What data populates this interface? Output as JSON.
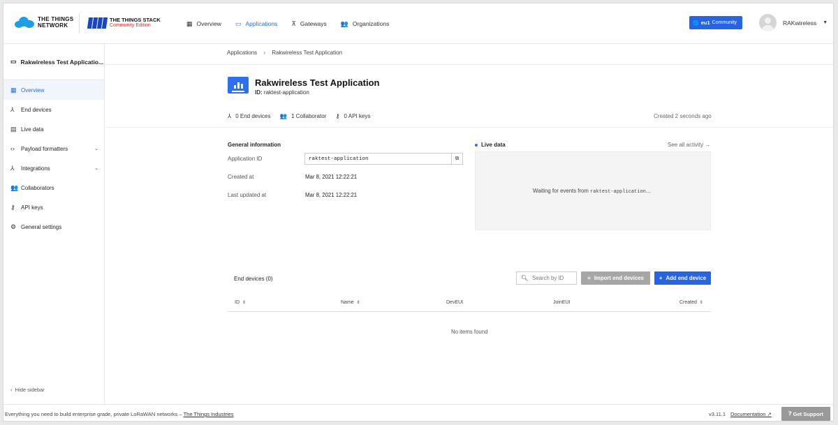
{
  "header": {
    "ttn_logo_line1": "THE THINGS",
    "ttn_logo_line2": "NETWORK",
    "tts_logo_line1": "THE THINGS STACK",
    "tts_logo_line2": "Community Edition",
    "nav": [
      {
        "label": "Overview",
        "icon": "dashboard-icon",
        "active": false
      },
      {
        "label": "Applications",
        "icon": "applications-icon",
        "active": true
      },
      {
        "label": "Gateways",
        "icon": "gateway-icon",
        "active": false
      },
      {
        "label": "Organizations",
        "icon": "organizations-icon",
        "active": false
      }
    ],
    "cluster": {
      "region": "eu1",
      "label": "Community"
    },
    "user": {
      "name": "RAKwireless"
    }
  },
  "sidebar": {
    "title": "Rakwireless Test Applicatio...",
    "items": [
      {
        "label": "Overview",
        "icon": "dashboard-icon",
        "active": true
      },
      {
        "label": "End devices",
        "icon": "devices-icon"
      },
      {
        "label": "Live data",
        "icon": "live-data-icon"
      },
      {
        "label": "Payload formatters",
        "icon": "code-icon",
        "expandable": true
      },
      {
        "label": "Integrations",
        "icon": "integrations-icon",
        "expandable": true
      },
      {
        "label": "Collaborators",
        "icon": "collaborators-icon"
      },
      {
        "label": "API keys",
        "icon": "key-icon"
      },
      {
        "label": "General settings",
        "icon": "gear-icon"
      }
    ],
    "hide_label": "Hide sidebar"
  },
  "breadcrumb": {
    "root": "Applications",
    "current": "Rakwireless Test Application"
  },
  "app": {
    "title": "Rakwireless Test Application",
    "id_label": "ID:",
    "id_value": "raktest-application",
    "stats": {
      "end_devices": "0 End devices",
      "collaborators": "1 Collaborator",
      "api_keys": "0 API keys"
    },
    "created_ago": "Created 2 seconds ago"
  },
  "general_info": {
    "title": "General information",
    "app_id_label": "Application ID",
    "app_id_value": "raktest-application",
    "created_label": "Created at",
    "created_value": "Mar 8, 2021 12:22:21",
    "updated_label": "Last updated at",
    "updated_value": "Mar 8, 2021 12:22:21"
  },
  "live_data": {
    "title": "Live data",
    "see_all": "See all activity →",
    "waiting_prefix": "Waiting for events from ",
    "waiting_id": "raktest-application",
    "waiting_suffix": "..."
  },
  "end_devices": {
    "title": "End devices (0)",
    "search_placeholder": "Search by ID",
    "import_label": "Import end devices",
    "add_label": "Add end device",
    "columns": [
      "ID",
      "Name",
      "DevEUI",
      "JoinEUI",
      "Created"
    ],
    "empty": "No items found"
  },
  "footer": {
    "tagline": "Everything you need to build enterprise grade, private LoRaWAN networks – ",
    "company": "The Things Industries",
    "version": "v3.11.1",
    "docs": "Documentation",
    "support": "Get Support"
  },
  "colors": {
    "primary": "#2563e8",
    "accent_red": "#e02828"
  }
}
